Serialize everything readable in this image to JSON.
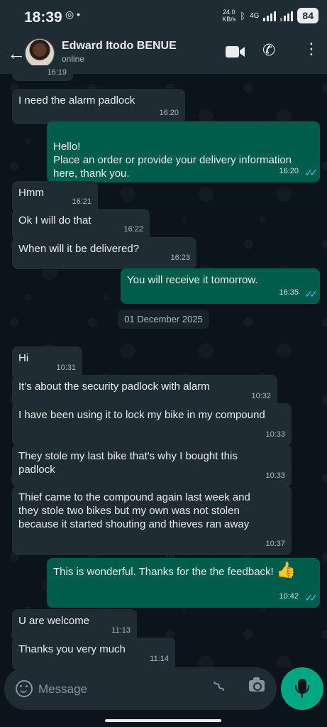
{
  "status_bar": {
    "time": "18:39",
    "speed_value": "24.0",
    "speed_unit": "KB/s",
    "network": "4G",
    "battery": "84"
  },
  "header": {
    "contact_name": "Edward Itodo BENUE",
    "contact_status": "online"
  },
  "messages": [
    {
      "text": "I need the alarm padlock",
      "time": "16:20",
      "direction": "in"
    },
    {
      "text": "Hello!\nPlace an order or provide your delivery information here, thank you.",
      "time": "16:20",
      "direction": "out"
    },
    {
      "text": "Hmm",
      "time": "16:21",
      "direction": "in"
    },
    {
      "text": "Ok I will do that",
      "time": "16:22",
      "direction": "in"
    },
    {
      "text": "When will it be delivered?",
      "time": "16:23",
      "direction": "in"
    },
    {
      "text": "You will receive it tomorrow.",
      "time": "16:35",
      "direction": "out"
    },
    {
      "text": "Hi",
      "time": "10:31",
      "direction": "in"
    },
    {
      "text": "It's about the security padlock with alarm",
      "time": "10:32",
      "direction": "in"
    },
    {
      "text": "I have been using it to lock my bike in my compound",
      "time": "10:33",
      "direction": "in"
    },
    {
      "text": "They stole my last bike that's why I bought this padlock",
      "time": "10:33",
      "direction": "in"
    },
    {
      "text": "Thief came to the compound again last week and they stole two bikes but my own was not stolen because it started shouting and thieves ran away",
      "time": "10:37",
      "direction": "in"
    },
    {
      "text": "This is wonderful. Thanks for the the feedback!",
      "emoji": "👍",
      "time": "10:42",
      "direction": "out"
    },
    {
      "text": "U are welcome",
      "time": "11:13",
      "direction": "in"
    },
    {
      "text": "Thanks you very much",
      "time": "11:14",
      "direction": "in"
    }
  ],
  "partial_top_time": "16:19",
  "date_separator": "01 December 2025",
  "composer": {
    "placeholder": "Message"
  },
  "colors": {
    "incoming_bubble": "#202c33",
    "outgoing_bubble": "#005c4b",
    "accent": "#00a884",
    "read_ticks": "#53bdeb"
  }
}
